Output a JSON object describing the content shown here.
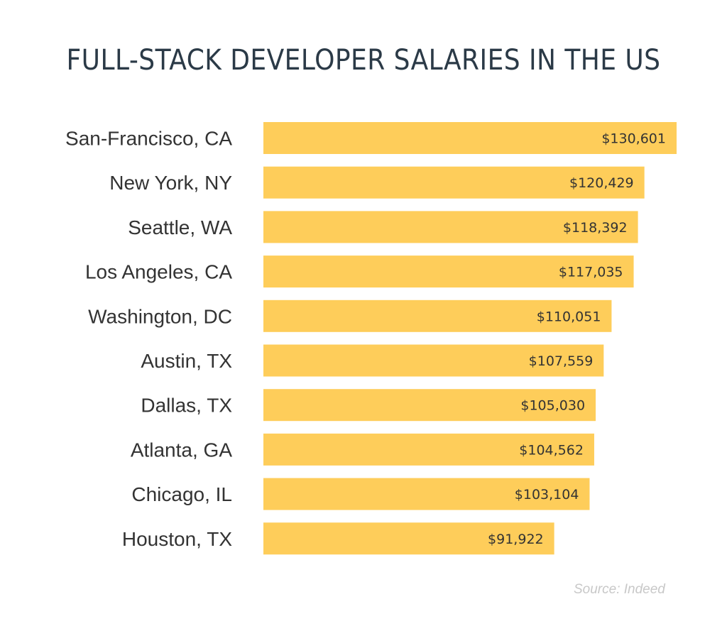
{
  "chart_data": {
    "type": "bar",
    "orientation": "horizontal",
    "title": "FULL-STACK DEVELOPER SALARIES IN THE US",
    "xlabel": "",
    "ylabel": "",
    "categories": [
      "San-Francisco, CA",
      "New York, NY",
      "Seattle, WA",
      "Los Angeles, CA",
      "Washington, DC",
      "Austin, TX",
      "Dallas, TX",
      "Atlanta, GA",
      "Chicago, IL",
      "Houston, TX"
    ],
    "values": [
      130601,
      120429,
      118392,
      117035,
      110051,
      107559,
      105030,
      104562,
      103104,
      91922
    ],
    "value_labels": [
      "$130,601",
      "$120,429",
      "$118,392",
      "$117,035",
      "$110,051",
      "$107,559",
      "$105,030",
      "$104,562",
      "$103,104",
      "$91,922"
    ],
    "xlim": [
      0,
      130601
    ],
    "grid": false,
    "legend": "none",
    "bar_color": "#fecd5a",
    "source": "Source: Indeed"
  }
}
